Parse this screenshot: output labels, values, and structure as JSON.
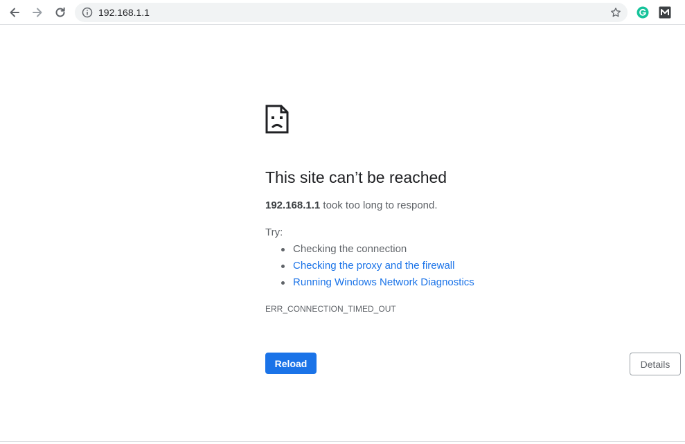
{
  "browser": {
    "url": "192.168.1.1",
    "icons": {
      "back": "arrow-left-icon",
      "forward": "arrow-right-icon",
      "reload": "reload-icon",
      "info": "info-icon",
      "bookmark": "star-icon",
      "grammarly": "grammarly-icon",
      "mailtrack": "mailtrack-icon"
    },
    "colors": {
      "grammarly": "#15c39a",
      "mailtrack": "#3c4043",
      "forward_disabled": "#9aa0a6"
    }
  },
  "error": {
    "icon": "sad-document-icon",
    "heading": "This site can’t be reached",
    "host": "192.168.1.1",
    "summary_suffix": " took too long to respond.",
    "try_label": "Try:",
    "suggestions": [
      {
        "text": "Checking the connection",
        "is_link": false
      },
      {
        "text": "Checking the proxy and the firewall",
        "is_link": true
      },
      {
        "text": "Running Windows Network Diagnostics",
        "is_link": true
      }
    ],
    "code": "ERR_CONNECTION_TIMED_OUT"
  },
  "buttons": {
    "reload_label": "Reload",
    "details_label": "Details"
  },
  "colors": {
    "primary": "#1a73e8",
    "text": "#202124",
    "secondary_text": "#5f6368"
  }
}
